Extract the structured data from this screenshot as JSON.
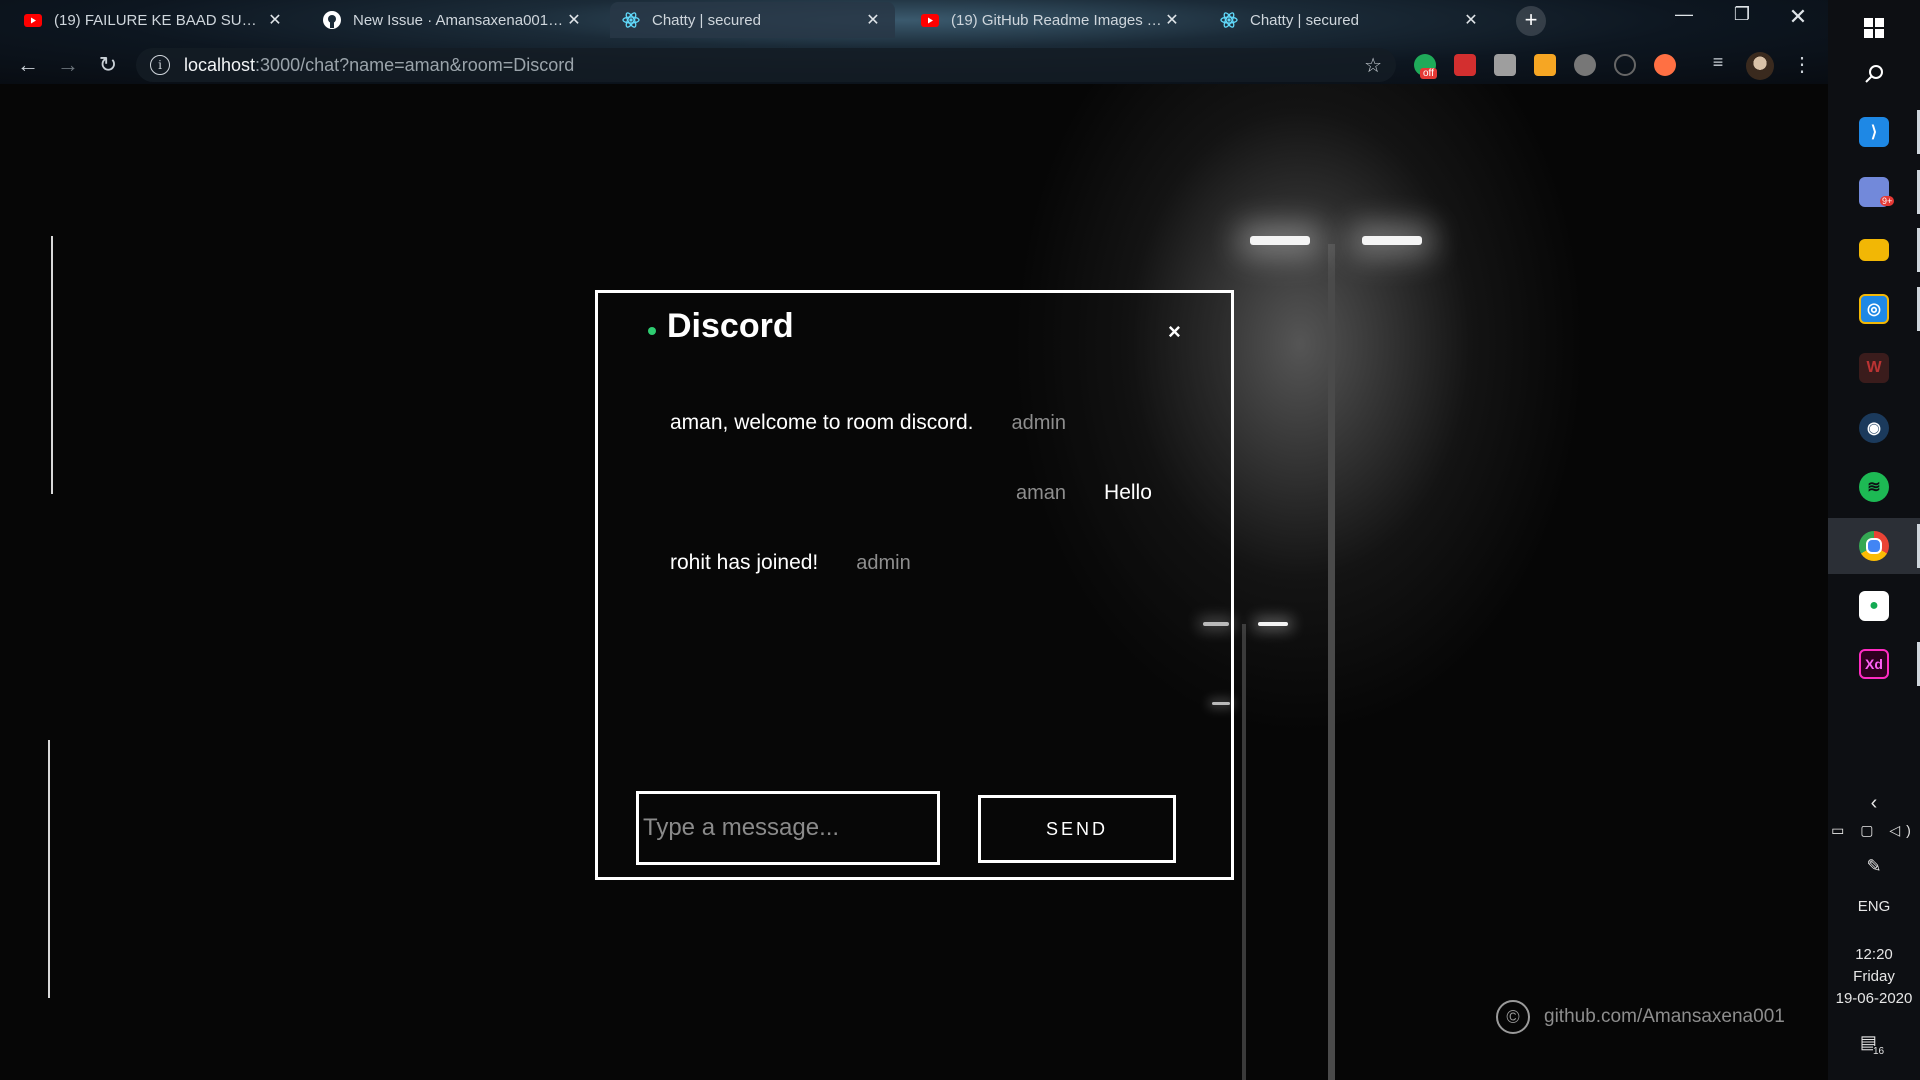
{
  "browser": {
    "tabs": [
      {
        "title": "(19) FAILURE KE BAAD SUCCESS",
        "favicon": "youtube-icon",
        "active": false
      },
      {
        "title": "New Issue · Amansaxena001/Cha",
        "favicon": "github-icon",
        "active": false
      },
      {
        "title": "Chatty | secured",
        "favicon": "react-icon",
        "active": true
      },
      {
        "title": "(19) GitHub Readme Images Tuto",
        "favicon": "youtube-icon",
        "active": false
      },
      {
        "title": "Chatty | secured",
        "favicon": "react-icon",
        "active": false
      }
    ],
    "address": {
      "host": "localhost",
      "path": ":3000/chat?name=aman&room=Discord"
    },
    "extension_badge": "off"
  },
  "chat": {
    "room_name": "Discord",
    "close_symbol": "×",
    "messages": [
      {
        "text": "aman, welcome to room discord.",
        "user": "admin",
        "self": false
      },
      {
        "text": "Hello",
        "user": "aman",
        "self": true
      },
      {
        "text": "rohit has joined!",
        "user": "admin",
        "self": false
      }
    ],
    "input_placeholder": "Type a message...",
    "send_label": "SEND"
  },
  "footer": {
    "copyright_symbol": "©",
    "credit": "github.com/Amansaxena001"
  },
  "taskbar": {
    "apps": [
      "vscode-icon",
      "discord-icon",
      "file-explorer-icon",
      "instagram-icon",
      "predator-icon",
      "steam-icon",
      "spotify-icon",
      "chrome-icon",
      "mongodb-icon",
      "adobe-xd-icon"
    ],
    "discord_badge": "9+",
    "language": "ENG",
    "time": "12:20",
    "day": "Friday",
    "date": "19-06-2020",
    "notification_count": "16"
  },
  "colors": {
    "online_dot": "#2ecc71",
    "username_gray": "#8e8e8e",
    "accent_white": "#ffffff"
  }
}
